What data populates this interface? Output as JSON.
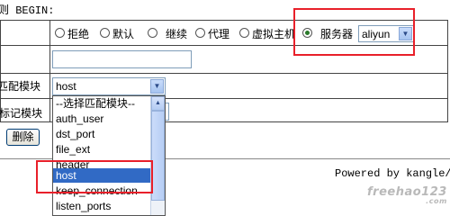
{
  "header": {
    "title": "则 BEGIN:"
  },
  "options_row": {
    "radios": [
      {
        "label": "拒绝",
        "checked": false
      },
      {
        "label": "默认",
        "checked": false
      },
      {
        "label": "继续",
        "checked": false
      },
      {
        "label": "代理",
        "checked": false
      },
      {
        "label": "虚拟主机",
        "checked": false
      },
      {
        "label": "服务器",
        "checked": true
      }
    ],
    "server_select": {
      "value": "aliyun"
    }
  },
  "match_module": {
    "label": "匹配模块",
    "select_value": "host",
    "dropdown_options": [
      "--选择匹配模块--",
      "auth_user",
      "dst_port",
      "file_ext",
      "header",
      "host",
      "keep_connection",
      "listen_ports"
    ],
    "selected_option": "host"
  },
  "mark_module": {
    "label": "标记模块"
  },
  "delete_button": {
    "label": "删除"
  },
  "footer": {
    "powered_by": "Powered by kangle/",
    "watermark": "freehao123",
    "watermark_sub": ".com"
  },
  "colors": {
    "highlight_box": "#e8202a",
    "selected_option_bg": "#316ac5"
  }
}
